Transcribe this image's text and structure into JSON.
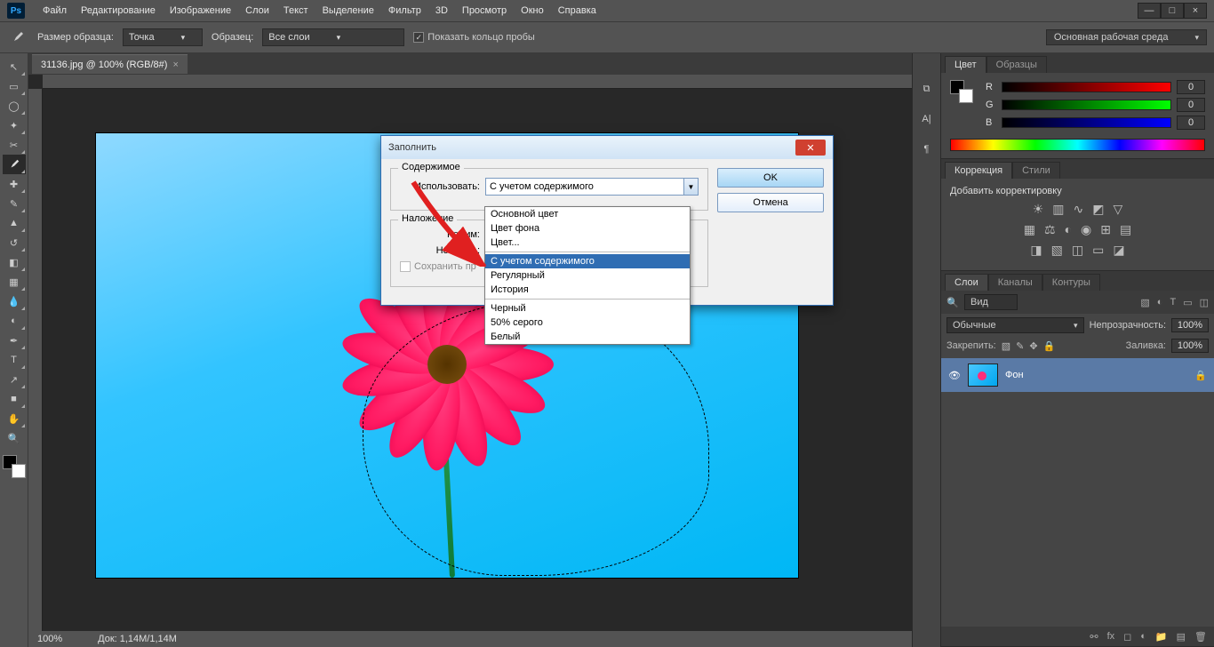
{
  "menu": [
    "Файл",
    "Редактирование",
    "Изображение",
    "Слои",
    "Текст",
    "Выделение",
    "Фильтр",
    "3D",
    "Просмотр",
    "Окно",
    "Справка"
  ],
  "window_controls": [
    "—",
    "□",
    "×"
  ],
  "options": {
    "sample_size_label": "Размер образца:",
    "sample_size_value": "Точка",
    "sample_label": "Образец:",
    "sample_value": "Все слои",
    "show_ring": "Показать кольцо пробы",
    "workspace": "Основная рабочая среда"
  },
  "doc_tab": "31136.jpg @ 100% (RGB/8#)",
  "status": {
    "zoom": "100%",
    "doc": "Док:   1,14М/1,14М"
  },
  "panels": {
    "color": {
      "tab1": "Цвет",
      "tab2": "Образцы",
      "r": "R",
      "g": "G",
      "b": "B",
      "val": "0"
    },
    "adjust": {
      "tab1": "Коррекция",
      "tab2": "Стили",
      "sub": "Добавить корректировку"
    },
    "layers": {
      "tab1": "Слои",
      "tab2": "Каналы",
      "tab3": "Контуры",
      "search": "Вид",
      "mode": "Обычные",
      "opacity_label": "Непрозрачность:",
      "opacity": "100%",
      "lock_label": "Закрепить:",
      "fill_label": "Заливка:",
      "fill": "100%",
      "layer_name": "Фон"
    }
  },
  "dialog": {
    "title": "Заполнить",
    "ok": "OK",
    "cancel": "Отмена",
    "group1": "Содержимое",
    "use_label": "Использовать:",
    "use_value": "С учетом содержимого",
    "group2": "Наложение",
    "mode_label": "Режим:",
    "opacity_label": "Непрозр.:",
    "preserve": "Сохранить пр",
    "options": [
      "Основной цвет",
      "Цвет фона",
      "Цвет...",
      "С учетом содержимого",
      "Регулярный",
      "История",
      "Черный",
      "50% серого",
      "Белый"
    ]
  },
  "tool_tips": [
    "move",
    "marquee",
    "lasso",
    "wand",
    "crop",
    "eyedropper",
    "healing",
    "brush",
    "stamp",
    "history-brush",
    "eraser",
    "gradient",
    "blur",
    "dodge",
    "pen",
    "type",
    "path",
    "rectangle",
    "hand",
    "zoom"
  ]
}
